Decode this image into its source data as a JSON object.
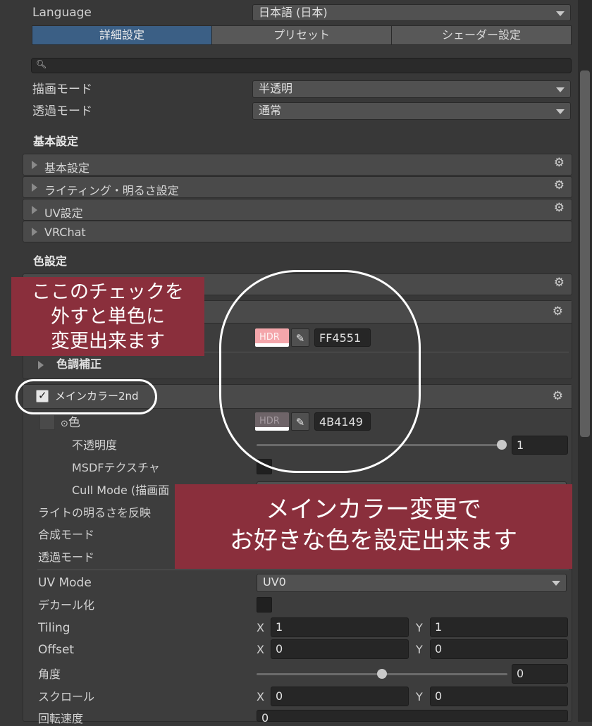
{
  "header": {
    "language_label": "Language",
    "language_value": "日本語 (日本)",
    "tabs": [
      "詳細設定",
      "プリセット",
      "シェーダー設定"
    ]
  },
  "search": {
    "icon": "search-icon",
    "value": ""
  },
  "rendering": {
    "render_mode_label": "描画モード",
    "render_mode_value": "半透明",
    "transparent_mode_label": "透過モード",
    "transparent_mode_value": "通常"
  },
  "basic_section": {
    "title": "基本設定",
    "foldouts": [
      "基本設定",
      "ライティング・明るさ設定",
      "UV設定",
      "VRChat"
    ]
  },
  "color_section": {
    "title": "色設定",
    "main_color_hex": "FF4551",
    "main_color_swatch": "#f4a6ab",
    "hdr_badge": "HDR",
    "tone_correction": "色調補正"
  },
  "main_color_2nd": {
    "title": "メインカラー2nd",
    "checked": true,
    "color_label": "色",
    "color_hex": "4B4149",
    "color_swatch": "#6e6468",
    "opacity_label": "不透明度",
    "opacity_value": "1",
    "opacity_fraction": 1.0,
    "msdf_label": "MSDFテクスチャ",
    "cull_mode_label": "Cull Mode (描画面",
    "lighting_label": "ライトの明るさを反映",
    "blend_mode_label": "合成モード",
    "transparent_mode_label": "透過モード",
    "uv_mode_label": "UV Mode",
    "uv_mode_value": "UV0",
    "decal_label": "デカール化",
    "tiling_label": "Tiling",
    "tiling_x": "1",
    "tiling_y": "1",
    "offset_label": "Offset",
    "offset_x": "0",
    "offset_y": "0",
    "angle_label": "角度",
    "angle_value": "0",
    "angle_fraction": 0.5,
    "scroll_label": "スクロール",
    "scroll_x": "0",
    "scroll_y": "0",
    "rotation_label": "回転速度",
    "rotation_value": "0",
    "x_axis": "X",
    "y_axis": "Y"
  },
  "annotations": {
    "note_checkbox_lines": [
      "ここのチェックを",
      "外すと単色に",
      "変更出来ます"
    ],
    "note_color_lines": [
      "メインカラー変更で",
      "お好きな色を設定出来ます"
    ],
    "ring_color": "#ffffff",
    "note_color": "#8a2f3c"
  }
}
